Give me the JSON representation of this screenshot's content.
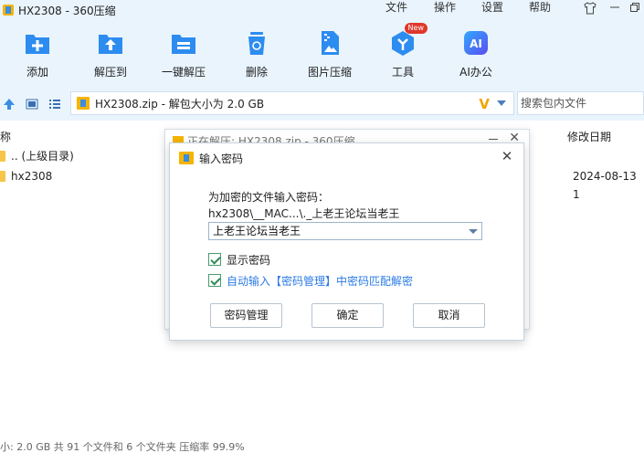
{
  "window": {
    "title": "HX2308 - 360压缩",
    "menu": [
      "文件",
      "操作",
      "设置",
      "帮助"
    ]
  },
  "toolbar": {
    "items": [
      {
        "label": "添加",
        "icon": "add-icon",
        "color": "#2d8cf0"
      },
      {
        "label": "解压到",
        "icon": "extract-to-icon",
        "color": "#2d8cf0"
      },
      {
        "label": "一键解压",
        "icon": "one-click-extract-icon",
        "color": "#2d8cf0"
      },
      {
        "label": "删除",
        "icon": "delete-icon",
        "color": "#2d8cf0"
      },
      {
        "label": "图片压缩",
        "icon": "image-compress-icon",
        "color": "#2d8cf0"
      },
      {
        "label": "工具",
        "icon": "tools-icon",
        "color": "#2d8cf0",
        "badge": "New"
      },
      {
        "label": "AI办公",
        "icon": "ai-office-icon",
        "color": "#3a6df0"
      }
    ]
  },
  "address": {
    "path": "HX2308.zip - 解包大小为 2.0 GB",
    "search_placeholder": "搜索包内文件"
  },
  "file_list": {
    "columns": [
      "称",
      "修改日期"
    ],
    "rows": [
      {
        "name": ".. (上级目录)",
        "date": ""
      },
      {
        "name": "hx2308",
        "date": "2024-08-13 1"
      }
    ]
  },
  "status": "小: 2.0 GB 共 91 个文件和 6 个文件夹 压缩率 99.9%",
  "progress_window": {
    "title": "正在解压: HX2308.zip - 360压缩"
  },
  "dialog": {
    "title": "输入密码",
    "prompt": "为加密的文件输入密码：",
    "file": "hx2308\\__MAC...\\._上老王论坛当老王",
    "password_value": "上老王论坛当老王",
    "show_password_label": "显示密码",
    "auto_input_label": "自动输入【密码管理】中密码匹配解密",
    "buttons": {
      "manage": "密码管理",
      "ok": "确定",
      "cancel": "取消"
    }
  },
  "colors": {
    "accent": "#2d8cf0",
    "toolbar_bg": "#e9f4fd",
    "link_blue": "#2c7be5"
  }
}
